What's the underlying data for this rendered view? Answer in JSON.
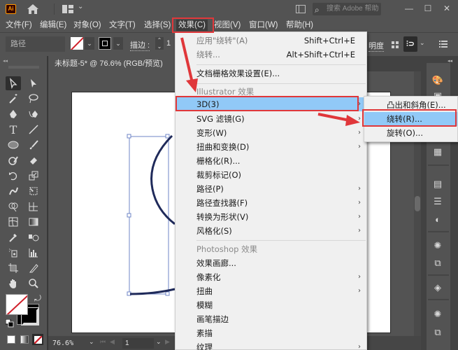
{
  "app": {
    "logo": "Ai",
    "icons": {
      "home": "home-icon",
      "layout": "workspace-layout-icon"
    },
    "search_placeholder": "搜索 Adobe 帮助",
    "window_buttons": {
      "minimize": "—",
      "maximize": "☐",
      "close": "✕"
    }
  },
  "menubar": {
    "items": [
      {
        "label": "文件(F)"
      },
      {
        "label": "编辑(E)"
      },
      {
        "label": "对象(O)"
      },
      {
        "label": "文字(T)"
      },
      {
        "label": "选择(S)"
      },
      {
        "label": "效果(C)",
        "active": true
      },
      {
        "label": "视图(V)"
      },
      {
        "label": "窗口(W)"
      },
      {
        "label": "帮助(H)"
      }
    ]
  },
  "controlbar": {
    "selection_type": "路径",
    "stroke_label": "描边 :",
    "stroke_value": "1",
    "opacity_label": "明度",
    "arrange_label": "⫶⊃"
  },
  "document": {
    "tab_title": "未标题-5* @ 76.6% (RGB/预览)"
  },
  "statusbar": {
    "zoom": "76.6%",
    "page": "1"
  },
  "effect_menu": {
    "items": [
      {
        "label": "应用\"绕转\"(A)",
        "shortcut": "Shift+Ctrl+E",
        "state": "disabled"
      },
      {
        "label": "绕转...",
        "shortcut": "Alt+Shift+Ctrl+E",
        "state": "disabled"
      },
      {
        "type": "separator"
      },
      {
        "label": "文档栅格效果设置(E)...",
        "state": "normal"
      },
      {
        "type": "separator"
      },
      {
        "label": "Illustrator 效果",
        "state": "header"
      },
      {
        "label": "3D(3)",
        "state": "highlighted",
        "submenu": true
      },
      {
        "label": "SVG 滤镜(G)",
        "state": "normal",
        "submenu": true
      },
      {
        "label": "变形(W)",
        "state": "normal",
        "submenu": true
      },
      {
        "label": "扭曲和变换(D)",
        "state": "normal",
        "submenu": true
      },
      {
        "label": "栅格化(R)...",
        "state": "normal"
      },
      {
        "label": "裁剪标记(O)",
        "state": "normal"
      },
      {
        "label": "路径(P)",
        "state": "normal",
        "submenu": true
      },
      {
        "label": "路径查找器(F)",
        "state": "normal",
        "submenu": true
      },
      {
        "label": "转换为形状(V)",
        "state": "normal",
        "submenu": true
      },
      {
        "label": "风格化(S)",
        "state": "normal",
        "submenu": true
      },
      {
        "type": "separator"
      },
      {
        "label": "Photoshop 效果",
        "state": "header"
      },
      {
        "label": "效果画廊...",
        "state": "normal"
      },
      {
        "label": "像素化",
        "state": "normal",
        "submenu": true
      },
      {
        "label": "扭曲",
        "state": "normal",
        "submenu": true
      },
      {
        "label": "模糊",
        "state": "normal"
      },
      {
        "label": "画笔描边",
        "state": "normal"
      },
      {
        "label": "素描",
        "state": "normal"
      },
      {
        "label": "纹理",
        "state": "normal",
        "submenu": true
      }
    ]
  },
  "submenu_3d": {
    "items": [
      {
        "label": "凸出和斜角(E)...",
        "state": "normal"
      },
      {
        "label": "绕转(R)...",
        "state": "highlighted"
      },
      {
        "label": "旋转(O)...",
        "state": "normal"
      }
    ]
  },
  "colors": {
    "menu_highlight": "#91c9f7",
    "annotation_red": "#e0373a",
    "ui_dark": "#535353",
    "path_stroke": "#1f2a5a",
    "selection_blue": "#6f86c7"
  }
}
